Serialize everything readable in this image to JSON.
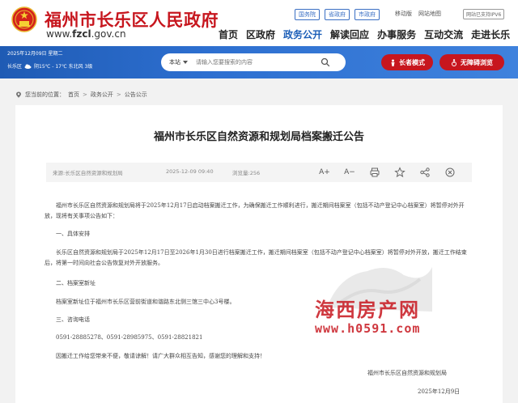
{
  "header": {
    "site_title": "福州市长乐区人民政府",
    "site_url_prefix": "www.",
    "site_url_domain": "fzcl",
    "site_url_suffix": ".gov.cn",
    "top_links": [
      "国务院",
      "省政府",
      "市政府"
    ],
    "util_links": [
      "移动版",
      "网站地图"
    ],
    "ipv6": "网站已支持IPV6",
    "nav": [
      "首页",
      "区政府",
      "政务公开",
      "解读回应",
      "办事服务",
      "互动交流",
      "走进长乐"
    ],
    "nav_active_index": 2
  },
  "banner": {
    "date": "2025年12月09日 星期二",
    "location": "长乐区",
    "weather": "阴15℃ - 17℃ 东北风 3级",
    "search_scope": "本站",
    "search_placeholder": "请输入您要搜索的内容",
    "elder_mode": "长者模式",
    "accessibility": "无障碍浏览"
  },
  "breadcrumb": {
    "label": "您当前的位置：",
    "items": [
      "首页",
      "政务公开",
      "公告公示"
    ]
  },
  "article": {
    "title": "福州市长乐区自然资源和规划局档案搬迁公告",
    "source": "来源:长乐区自然资源和规划局",
    "datetime": "2025-12-09 09:40",
    "views": "浏览量:256",
    "tools": [
      "A+",
      "A−"
    ],
    "p1": "福州市长乐区自然资源和规划局将于2025年12月17日启动档案搬迁工作，为确保搬迁工作顺利进行，搬迁期间档案室（包括不动产登记中心档案室）将暂停对外开放，现将有关事项公告如下：",
    "h1": "一、具体安排",
    "p2": "长乐区自然资源和规划局于2025年12月17日至2026年1月30日进行档案搬迁工作，搬迁期间档案室（包括不动产登记中心档案室）将暂停对外开放，搬迁工作结束后，将第一时间向社会公告恢复对外开放服务。",
    "h2": "二、档案室新址",
    "p3": "档案室新址位于福州市长乐区营前街道和谐路东北侧三馆三中心3号楼。",
    "h3": "三、咨询电话",
    "phones": "0591-28885278、0591-28985975、0591-28821821",
    "p4": "因搬迁工作给您带来不便，敬请谅解！请广大群众相互告知，感谢您的理解和支持！",
    "signature": "福州市长乐区自然资源和规划局",
    "sign_date": "2025年12月9日"
  },
  "watermark": {
    "text": "海西房产网",
    "url": "www.h0591.com"
  },
  "colors": {
    "brand_red": "#c7161e",
    "banner_blue": "#2d6fd0",
    "nav_active": "#1d5fb8"
  }
}
